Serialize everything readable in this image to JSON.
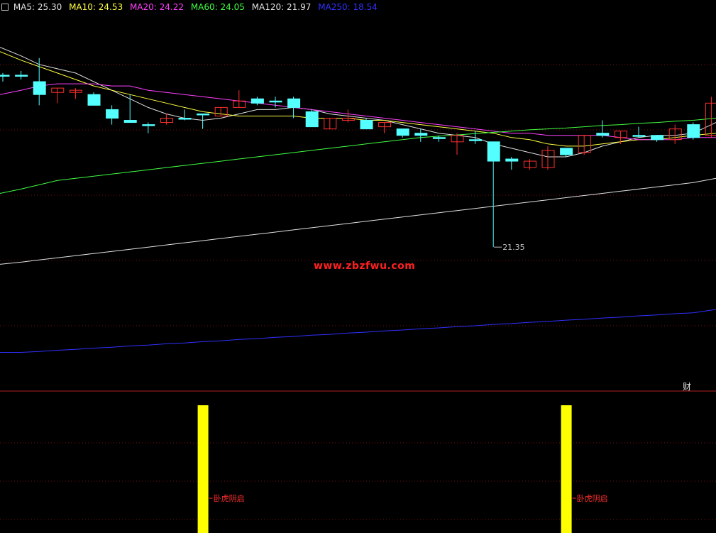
{
  "legend": [
    {
      "label": "MA5: 25.30",
      "color": "#e0e0e0"
    },
    {
      "label": "MA10: 24.53",
      "color": "#ffff40"
    },
    {
      "label": "MA20: 24.22",
      "color": "#ff40ff"
    },
    {
      "label": "MA60: 24.05",
      "color": "#40ff40"
    },
    {
      "label": "MA120: 21.97",
      "color": "#e0e0e0"
    },
    {
      "label": "MA250: 18.54",
      "color": "#3030ff"
    }
  ],
  "watermark": "www.zbzfwu.com",
  "cai_label": "财",
  "low_marker": "21.35",
  "signal_label": "卧虎阴启",
  "colors": {
    "bg": "#000000",
    "up": "#ff3030",
    "down": "#54ffff",
    "grid": "#7a1010",
    "ma5": "#e0e0e0",
    "ma10": "#ffff40",
    "ma20": "#ff40ff",
    "ma60": "#40ff40",
    "ma120": "#e0e0e0",
    "ma250": "#3030ff",
    "signal": "#ffff00"
  },
  "chart_data": [
    {
      "type": "candlestick",
      "ylim": [
        18.0,
        27.1
      ],
      "candles": [
        {
          "o": 25.35,
          "h": 25.4,
          "l": 25.2,
          "c": 25.35
        },
        {
          "o": 25.35,
          "h": 25.45,
          "l": 25.25,
          "c": 25.35
        },
        {
          "o": 25.2,
          "h": 25.75,
          "l": 24.65,
          "c": 24.9
        },
        {
          "o": 24.95,
          "h": 25.05,
          "l": 24.7,
          "c": 25.05
        },
        {
          "o": 24.95,
          "h": 25.05,
          "l": 24.8,
          "c": 25.0
        },
        {
          "o": 24.9,
          "h": 24.95,
          "l": 24.65,
          "c": 24.65
        },
        {
          "o": 24.55,
          "h": 24.65,
          "l": 24.2,
          "c": 24.35
        },
        {
          "o": 24.3,
          "h": 24.9,
          "l": 24.25,
          "c": 24.25
        },
        {
          "o": 24.2,
          "h": 24.25,
          "l": 24.0,
          "c": 24.2
        },
        {
          "o": 24.25,
          "h": 24.45,
          "l": 24.2,
          "c": 24.35
        },
        {
          "o": 24.35,
          "h": 24.55,
          "l": 24.3,
          "c": 24.35
        },
        {
          "o": 24.45,
          "h": 24.45,
          "l": 24.1,
          "c": 24.45
        },
        {
          "o": 24.4,
          "h": 24.6,
          "l": 24.4,
          "c": 24.6
        },
        {
          "o": 24.6,
          "h": 25.0,
          "l": 24.6,
          "c": 24.75
        },
        {
          "o": 24.8,
          "h": 24.85,
          "l": 24.65,
          "c": 24.7
        },
        {
          "o": 24.75,
          "h": 24.85,
          "l": 24.6,
          "c": 24.75
        },
        {
          "o": 24.8,
          "h": 24.85,
          "l": 24.35,
          "c": 24.6
        },
        {
          "o": 24.5,
          "h": 24.55,
          "l": 24.15,
          "c": 24.15
        },
        {
          "o": 24.1,
          "h": 24.35,
          "l": 24.1,
          "c": 24.35
        },
        {
          "o": 24.3,
          "h": 24.55,
          "l": 24.25,
          "c": 24.35
        },
        {
          "o": 24.3,
          "h": 24.35,
          "l": 24.1,
          "c": 24.1
        },
        {
          "o": 24.15,
          "h": 24.25,
          "l": 24.0,
          "c": 24.25
        },
        {
          "o": 24.1,
          "h": 24.1,
          "l": 23.9,
          "c": 23.95
        },
        {
          "o": 24.0,
          "h": 24.1,
          "l": 23.8,
          "c": 23.95
        },
        {
          "o": 23.9,
          "h": 23.95,
          "l": 23.8,
          "c": 23.9
        },
        {
          "o": 23.8,
          "h": 24.0,
          "l": 23.5,
          "c": 23.95
        },
        {
          "o": 23.85,
          "h": 24.05,
          "l": 23.75,
          "c": 23.85
        },
        {
          "o": 23.8,
          "h": 23.8,
          "l": 21.35,
          "c": 23.35
        },
        {
          "o": 23.4,
          "h": 23.45,
          "l": 23.15,
          "c": 23.35
        },
        {
          "o": 23.2,
          "h": 23.4,
          "l": 23.15,
          "c": 23.35
        },
        {
          "o": 23.2,
          "h": 23.7,
          "l": 23.15,
          "c": 23.6
        },
        {
          "o": 23.65,
          "h": 23.65,
          "l": 23.45,
          "c": 23.5
        },
        {
          "o": 23.55,
          "h": 23.95,
          "l": 23.5,
          "c": 23.95
        },
        {
          "o": 24.0,
          "h": 24.3,
          "l": 23.9,
          "c": 23.95
        },
        {
          "o": 23.9,
          "h": 24.05,
          "l": 23.75,
          "c": 24.05
        },
        {
          "o": 23.95,
          "h": 24.15,
          "l": 23.9,
          "c": 23.95
        },
        {
          "o": 23.95,
          "h": 23.95,
          "l": 23.8,
          "c": 23.85
        },
        {
          "o": 23.85,
          "h": 24.2,
          "l": 23.75,
          "c": 24.1
        },
        {
          "o": 24.2,
          "h": 24.25,
          "l": 23.85,
          "c": 23.9
        },
        {
          "o": 23.95,
          "h": 24.85,
          "l": 23.9,
          "c": 24.7
        }
      ],
      "ma": {
        "ma5": [
          26.0,
          25.8,
          25.6,
          25.5,
          25.4,
          25.2,
          25.0,
          24.8,
          24.6,
          24.45,
          24.35,
          24.3,
          24.35,
          24.45,
          24.55,
          24.55,
          24.6,
          24.55,
          24.45,
          24.4,
          24.35,
          24.3,
          24.2,
          24.1,
          24.0,
          23.95,
          23.9,
          23.75,
          23.65,
          23.55,
          23.45,
          23.45,
          23.55,
          23.7,
          23.8,
          23.9,
          23.95,
          23.95,
          24.0,
          24.25
        ],
        "ma10": [
          25.9,
          25.7,
          25.55,
          25.4,
          25.25,
          25.1,
          25.0,
          24.9,
          24.8,
          24.7,
          24.6,
          24.5,
          24.45,
          24.4,
          24.4,
          24.4,
          24.4,
          24.35,
          24.35,
          24.35,
          24.3,
          24.3,
          24.25,
          24.2,
          24.15,
          24.1,
          24.05,
          24.0,
          23.9,
          23.85,
          23.75,
          23.7,
          23.7,
          23.75,
          23.8,
          23.85,
          23.85,
          23.9,
          23.95,
          24.0
        ],
        "ma20": [
          24.9,
          25.0,
          25.1,
          25.15,
          25.15,
          25.15,
          25.1,
          25.1,
          25.0,
          24.95,
          24.9,
          24.85,
          24.8,
          24.75,
          24.7,
          24.65,
          24.6,
          24.55,
          24.5,
          24.45,
          24.4,
          24.35,
          24.3,
          24.25,
          24.2,
          24.15,
          24.1,
          24.05,
          24.0,
          24.0,
          23.95,
          23.95,
          23.95,
          23.95,
          23.9,
          23.85,
          23.85,
          23.85,
          23.9,
          23.9
        ],
        "ma60": [
          22.6,
          22.7,
          22.8,
          22.9,
          22.95,
          23.0,
          23.05,
          23.1,
          23.15,
          23.2,
          23.25,
          23.3,
          23.35,
          23.4,
          23.45,
          23.5,
          23.55,
          23.6,
          23.65,
          23.7,
          23.75,
          23.8,
          23.85,
          23.9,
          23.93,
          23.96,
          23.99,
          24.02,
          24.05,
          24.08,
          24.1,
          24.12,
          24.15,
          24.18,
          24.2,
          24.23,
          24.25,
          24.28,
          24.3,
          24.35
        ],
        "ma120": [
          20.95,
          21.0,
          21.05,
          21.1,
          21.15,
          21.2,
          21.25,
          21.3,
          21.35,
          21.4,
          21.45,
          21.5,
          21.55,
          21.6,
          21.65,
          21.7,
          21.75,
          21.8,
          21.85,
          21.9,
          21.95,
          22.0,
          22.05,
          22.1,
          22.15,
          22.2,
          22.25,
          22.3,
          22.35,
          22.4,
          22.45,
          22.5,
          22.55,
          22.6,
          22.65,
          22.7,
          22.75,
          22.8,
          22.85,
          22.95
        ],
        "ma250": [
          18.9,
          18.9,
          18.92,
          18.95,
          18.97,
          19.0,
          19.02,
          19.05,
          19.07,
          19.1,
          19.12,
          19.15,
          19.17,
          19.2,
          19.22,
          19.25,
          19.27,
          19.3,
          19.32,
          19.35,
          19.37,
          19.4,
          19.42,
          19.45,
          19.47,
          19.5,
          19.52,
          19.55,
          19.57,
          19.6,
          19.62,
          19.65,
          19.67,
          19.7,
          19.72,
          19.75,
          19.77,
          19.8,
          19.82,
          19.9
        ]
      }
    },
    {
      "type": "signal-bars",
      "signal_candles": [
        11,
        31
      ]
    }
  ]
}
